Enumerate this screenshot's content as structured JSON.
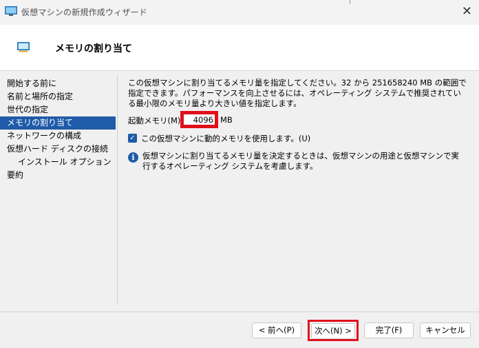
{
  "window": {
    "title": "仮想マシンの新規作成ウィザード",
    "close_glyph": "✕"
  },
  "header": {
    "title": "メモリの割り当て"
  },
  "nav": {
    "items": [
      {
        "label": "開始する前に"
      },
      {
        "label": "名前と場所の指定"
      },
      {
        "label": "世代の指定"
      },
      {
        "label": "メモリの割り当て"
      },
      {
        "label": "ネットワークの構成"
      },
      {
        "label": "仮想ハード ディスクの接続"
      },
      {
        "label": "インストール オプション"
      },
      {
        "label": "要約"
      }
    ],
    "selected_index": 3
  },
  "content": {
    "description": "この仮想マシンに割り当てるメモリ量を指定してください。32 から 251658240 MB の範囲で指定できます。パフォーマンスを向上させるには、オペレーティング システムで推奨されている最小限のメモリ量より大きい値を指定します。",
    "startup_memory_label": "起動メモリ(M):",
    "startup_memory_value": "4096",
    "startup_memory_unit": "MB",
    "dynamic_memory_label": "この仮想マシンに動的メモリを使用します。(U)",
    "dynamic_memory_checked": true,
    "info_text": "仮想マシンに割り当てるメモリ量を決定するときは、仮想マシンの用途と仮想マシンで実行するオペレーティング システムを考慮します。"
  },
  "buttons": {
    "back": "< 前へ(P)",
    "next": "次へ(N) >",
    "finish": "完了(F)",
    "cancel": "キャンセル"
  },
  "colors": {
    "accent": "#1f5ba8",
    "highlight": "#e0101a"
  }
}
